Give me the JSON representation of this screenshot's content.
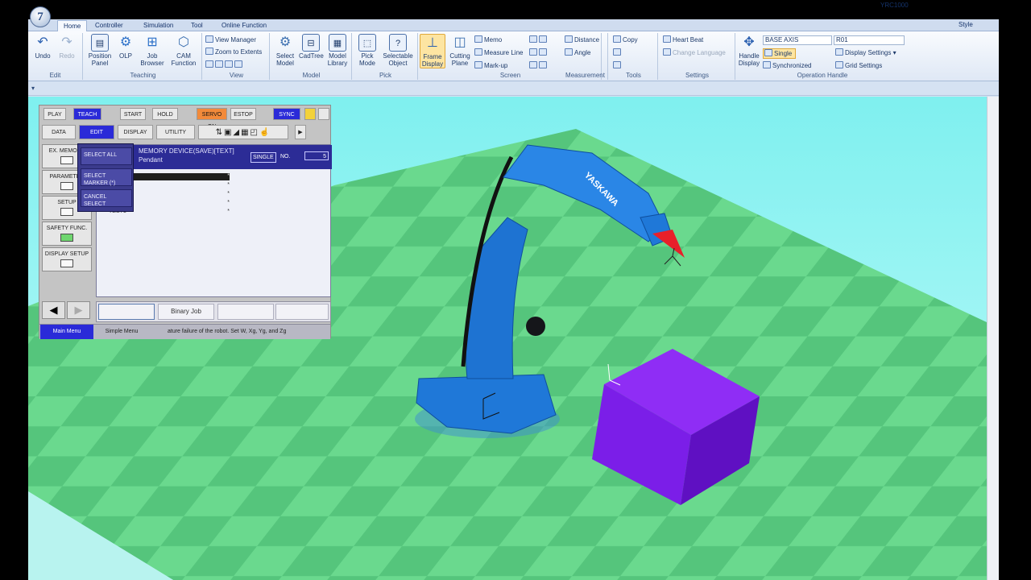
{
  "app": {
    "logo_label": "7",
    "controller_name": "YRC1000",
    "style_label": "Style"
  },
  "ribbon_tabs": [
    "Home",
    "Controller",
    "Simulation",
    "Tool",
    "Online Function"
  ],
  "ribbon": {
    "edit": {
      "label": "Edit",
      "undo": "Undo",
      "redo": "Redo"
    },
    "teaching": {
      "label": "Teaching",
      "position_panel": "Position Panel",
      "olp": "OLP",
      "job_browser": "Job Browser",
      "cam_function": "CAM Function"
    },
    "view": {
      "label": "View",
      "view_manager": "View Manager",
      "zoom_to_extents": "Zoom to Extents"
    },
    "model": {
      "label": "Model",
      "select_model": "Select Model",
      "cadtree": "CadTree",
      "model_library": "Model Library"
    },
    "pick": {
      "label": "Pick",
      "pick_mode": "Pick Mode",
      "selectable_object": "Selectable Object"
    },
    "screen": {
      "label": "Screen",
      "frame_display": "Frame Display",
      "cutting_plane": "Cutting Plane",
      "memo": "Memo",
      "measure_line": "Measure Line",
      "markup": "Mark-up"
    },
    "measurement": {
      "label": "Measurement",
      "distance": "Distance",
      "angle": "Angle"
    },
    "tools": {
      "label": "Tools",
      "copy": "Copy"
    },
    "settings": {
      "label": "Settings",
      "heart_beat": "Heart Beat",
      "change_language": "Change Language"
    },
    "operation_handle": {
      "label": "Operation Handle",
      "handle_display": "Handle Display",
      "base_axis": "BASE AXIS",
      "robot": "R01",
      "single": "Single",
      "synchronized": "Synchronized",
      "display_settings": "Display Settings",
      "grid_settings": "Grid Settings"
    }
  },
  "pendant": {
    "top_keys": [
      "PLAY",
      "TEACH",
      "START",
      "HOLD",
      "SERVO ON",
      "ESTOP",
      "SYNC"
    ],
    "menu_keys": [
      "DATA",
      "EDIT",
      "DISPLAY",
      "UTILITY"
    ],
    "left_keys": [
      "EX. MEMORY",
      "PARAMETER",
      "SETUP",
      "SAFETY FUNC.",
      "DISPLAY SETUP"
    ],
    "header_line1": "MEMORY DEVICE(SAVE)[TEXT]",
    "header_line2": "Pendant",
    "single": "SINGLE",
    "no_label": "NO.",
    "no_value": "5",
    "rows": [
      {
        "name": "",
        "mark": "*"
      },
      {
        "name": "",
        "mark": "*"
      },
      {
        "name": "",
        "mark": "*"
      },
      {
        "name": "",
        "mark": "*"
      },
      {
        "name": "TEST1",
        "mark": "*"
      }
    ],
    "dropdown": [
      "SELECT ALL",
      "SELECT MARKER (*)",
      "CANCEL SELECT"
    ],
    "bottom_field": "Binary Job",
    "status": {
      "main_menu": "Main Menu",
      "simple_menu": "Simple Menu",
      "message": "ature failure of the robot. Set W, Xg, Yg, and Zg"
    }
  },
  "scene": {
    "robot_brand": "YASKAWA",
    "colors": {
      "robot": "#1f78d8",
      "workpiece": "#7b1ee8",
      "floor_light": "#6ad98e",
      "floor_dark": "#4fbf79",
      "tool_tip": "#e8202a"
    }
  }
}
